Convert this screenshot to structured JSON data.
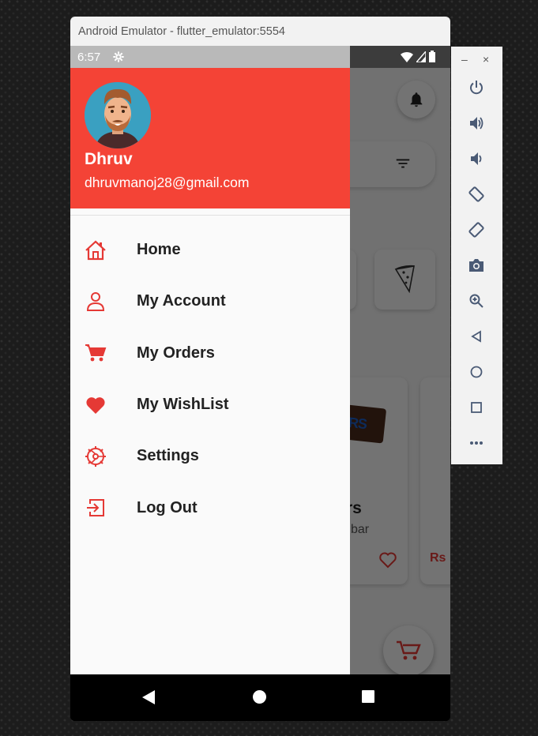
{
  "window": {
    "title": "Android Emulator - flutter_emulator:5554"
  },
  "status_bar": {
    "time": "6:57"
  },
  "drawer": {
    "user_name": "Dhruv",
    "user_email": "dhruvmanoj28@gmail.com",
    "items": [
      {
        "label": "Home",
        "icon": "home-icon"
      },
      {
        "label": "My Account",
        "icon": "person-icon"
      },
      {
        "label": "My Orders",
        "icon": "cart-icon"
      },
      {
        "label": "My WishList",
        "icon": "heart-icon"
      },
      {
        "label": "Settings",
        "icon": "settings-icon"
      },
      {
        "label": "Log Out",
        "icon": "logout-icon"
      }
    ]
  },
  "background_app": {
    "product_name_partial": "rs",
    "product_sub_partial": "bar",
    "price_partial": "Rs",
    "candy_label_partial": "RS"
  },
  "toolbar": {
    "minimize": "–",
    "close": "×",
    "buttons": [
      "power-icon",
      "volume-up-icon",
      "volume-down-icon",
      "rotate-left-icon",
      "rotate-right-icon",
      "camera-icon",
      "zoom-icon",
      "back-icon",
      "home-circle-icon",
      "overview-icon",
      "more-icon"
    ]
  },
  "colors": {
    "accent": "#f44336",
    "icon_red": "#e53935"
  }
}
